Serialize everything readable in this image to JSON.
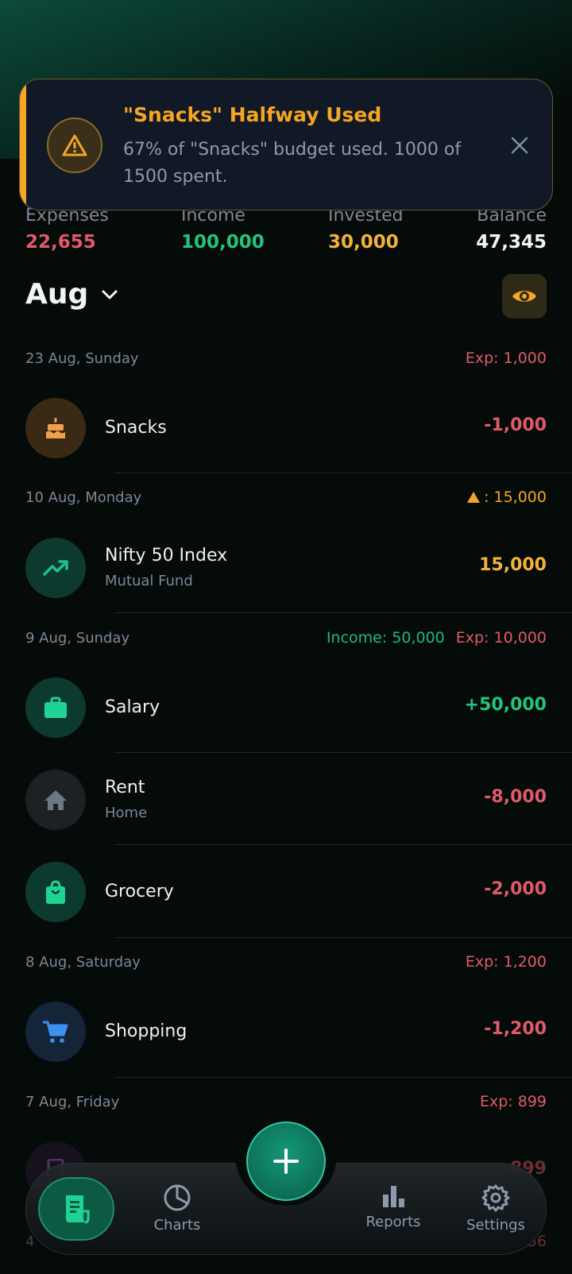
{
  "toast": {
    "title": "\"Snacks\" Halfway Used",
    "message": "67% of \"Snacks\" budget used. 1000 of 1500 spent.",
    "icon": "warning-icon",
    "accent": "#f5a623"
  },
  "summary": {
    "expenses_label": "Expenses",
    "expenses_value": "22,655",
    "income_label": "Income",
    "income_value": "100,000",
    "invested_label": "Invested",
    "invested_value": "30,000",
    "balance_label": "Balance",
    "balance_value": "47,345"
  },
  "month": {
    "label": "Aug"
  },
  "days": [
    {
      "date": "23 Aug, Sunday",
      "exp": "Exp: 1,000",
      "tx": [
        {
          "name": "Snacks",
          "amount": "-1,000",
          "icon": "cake-icon"
        }
      ]
    },
    {
      "date": "10 Aug, Monday",
      "invested": ": 15,000",
      "tx": [
        {
          "name": "Nifty 50 Index",
          "sub": "Mutual Fund",
          "amount": "15,000",
          "icon": "trending-up-icon"
        }
      ]
    },
    {
      "date": "9 Aug, Sunday",
      "income": "Income: 50,000",
      "exp": "Exp: 10,000",
      "tx": [
        {
          "name": "Salary",
          "amount": "+50,000",
          "icon": "briefcase-icon"
        },
        {
          "name": "Rent",
          "sub": "Home",
          "amount": "-8,000",
          "icon": "home-icon"
        },
        {
          "name": "Grocery",
          "amount": "-2,000",
          "icon": "shopping-bag-icon"
        }
      ]
    },
    {
      "date": "8 Aug, Saturday",
      "exp": "Exp: 1,200",
      "tx": [
        {
          "name": "Shopping",
          "amount": "-1,200",
          "icon": "cart-icon"
        }
      ]
    },
    {
      "date": "7 Aug, Friday",
      "exp": "Exp: 899",
      "tx": [
        {
          "name": "",
          "amount": "-899",
          "icon": "phone-icon"
        }
      ]
    },
    {
      "date": "4",
      "amount_partial": "56"
    }
  ],
  "nav": {
    "home_icon": "receipt-icon",
    "charts": "Charts",
    "add": "add-icon",
    "reports": "Reports",
    "settings": "Settings"
  },
  "colors": {
    "expense": "#e15a6a",
    "income": "#23c47f",
    "invested": "#f5b23a",
    "accent": "#149777"
  }
}
